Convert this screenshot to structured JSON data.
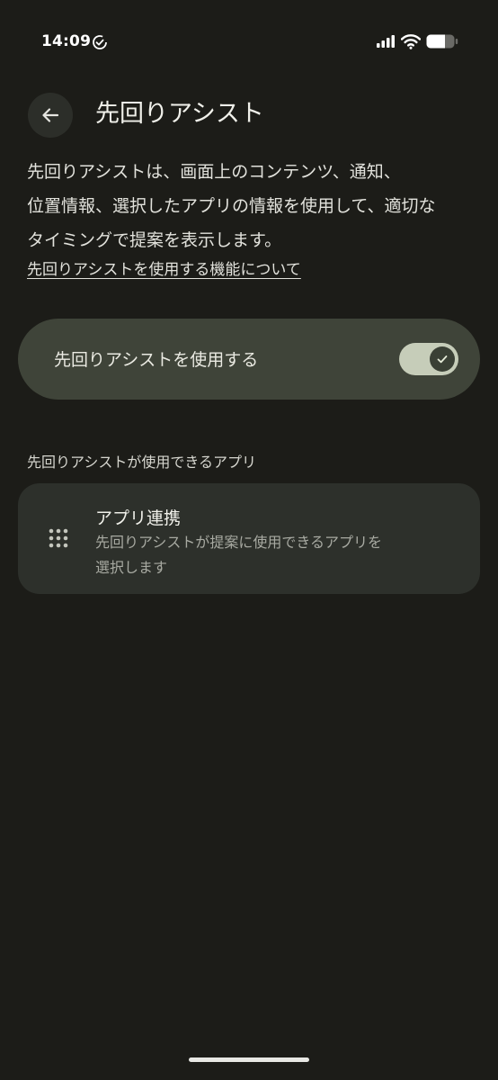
{
  "status_bar": {
    "time": "14:09"
  },
  "header": {
    "title": "先回りアシスト",
    "back_icon": "arrow-left-icon"
  },
  "description": {
    "lines": [
      "先回りアシストは、画面上のコンテンツ、通知、",
      "位置情報、選択したアプリの情報を使用して、適切な",
      "タイミングで提案を表示します。"
    ],
    "link": "先回りアシストを使用する機能について"
  },
  "main_toggle": {
    "label": "先回りアシストを使用する",
    "enabled": true
  },
  "apps_section": {
    "label": "先回りアシストが使用できるアプリ",
    "items": [
      {
        "icon": "grid-icon",
        "title": "アプリ連携",
        "description_lines": [
          "先回りアシストが提案に使用できるアプリを",
          "選択します"
        ]
      }
    ]
  },
  "colors": {
    "background": "#1c1c18",
    "toggle_card": "#3f4439",
    "app_card": "#2d302b",
    "switch_track": "#c6cdb9"
  }
}
